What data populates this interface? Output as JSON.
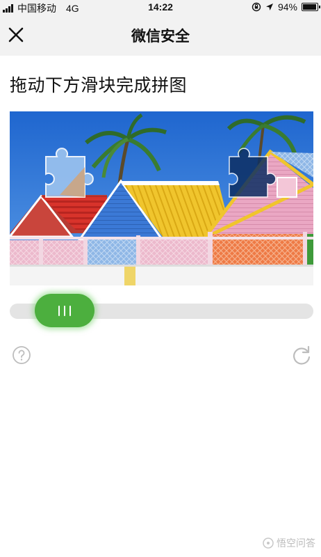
{
  "status_bar": {
    "carrier": "中国移动",
    "network": "4G",
    "time": "14:22",
    "battery_percent": "94%",
    "battery_level": 0.94,
    "icons": [
      "signal-icon",
      "orientation-lock-icon",
      "location-icon",
      "battery-icon"
    ]
  },
  "nav": {
    "title": "微信安全",
    "close_icon": "close-icon"
  },
  "captcha": {
    "instruction": "拖动下方滑块完成拼图",
    "image_description_icon": "puzzle-image",
    "slider_handle_icon": "grip-lines-icon",
    "help_icon": "question-icon",
    "refresh_icon": "refresh-icon"
  },
  "watermark": {
    "text": "悟空问答"
  },
  "colors": {
    "nav_background": "#f2f2f2",
    "slider_track": "#e4e4e4",
    "slider_handle": "#4caf3e",
    "sky": "#2a77d9"
  }
}
